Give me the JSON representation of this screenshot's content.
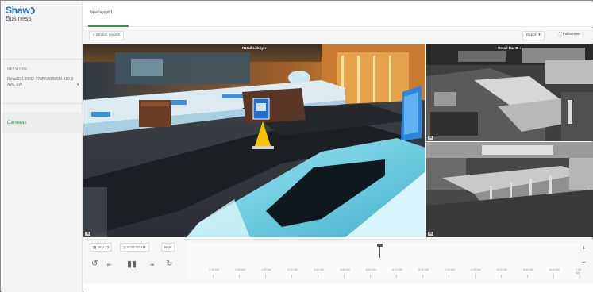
{
  "brand": {
    "name": "Shaw",
    "sub": "Business"
  },
  "sidebar": {
    "network_label": "NETWORK",
    "network_value": "Retail231-0692-77M9VR8M5M-410 3 AVE SW",
    "cameras_label": "Cameras"
  },
  "tabs": [
    {
      "label": "New layout 1",
      "active": true
    }
  ],
  "toolbar": {
    "motion_search": "Motion search",
    "export": "Export",
    "fullscreen": "Fullscreen"
  },
  "cameras": [
    {
      "title": "Retail Lobby"
    },
    {
      "title": "Retail Bar B"
    },
    {
      "title": ""
    }
  ],
  "player": {
    "date": "Nov 23",
    "time": "6:00:00 AM",
    "now": "Now",
    "tick_labels": [
      "3:30 AM",
      "3:45 AM",
      "4:00 AM",
      "4:15 AM",
      "4:30 AM",
      "4:45 AM",
      "5:00 AM",
      "5:15 AM",
      "5:30 AM",
      "5:45 AM",
      "6:00 AM",
      "6:15 AM",
      "6:30 AM",
      "6:45 AM",
      "7:00 AM"
    ]
  },
  "colors": {
    "accent": "#2e9a49",
    "brand": "#1f6fb8"
  },
  "icons": [
    "search-icon",
    "calendar-icon",
    "clock-icon",
    "rewind-icon",
    "skip-back-icon",
    "pause-icon",
    "skip-forward-icon",
    "forward-icon",
    "fullscreen-icon",
    "zoom-in-icon",
    "zoom-out-icon"
  ]
}
